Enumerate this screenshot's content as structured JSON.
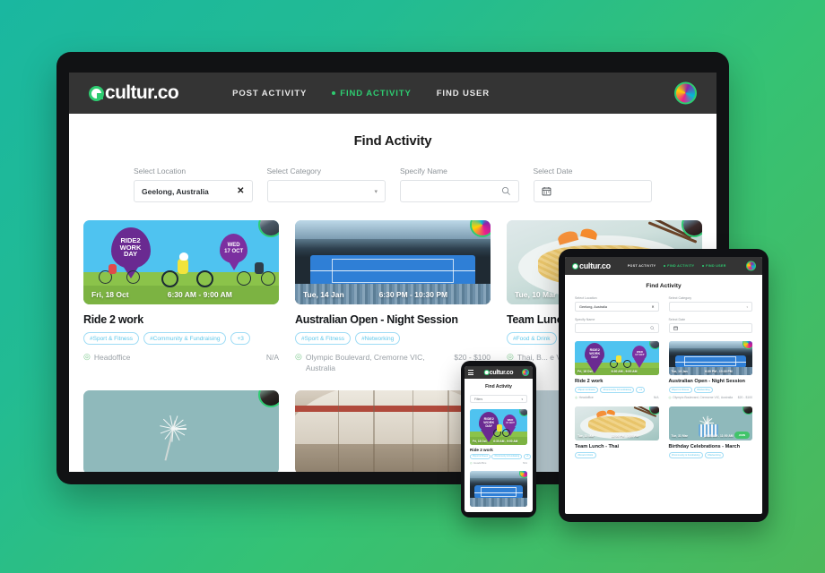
{
  "brand": {
    "name": "cultur.co",
    "accent_green": "#2ecc71",
    "nav_bg": "#343434"
  },
  "background": {
    "gradient_from": "#1ab7a0",
    "gradient_to": "#4db85a"
  },
  "desktop": {
    "nav": {
      "links": [
        {
          "label": "POST ACTIVITY",
          "active": false
        },
        {
          "label": "FIND ACTIVITY",
          "active": true
        },
        {
          "label": "FIND USER",
          "active": false
        }
      ],
      "avatar_name": "user-avatar"
    },
    "page_title": "Find Activity",
    "filters": [
      {
        "label": "Select Location",
        "value": "Geelong, Australia",
        "placeholder": "",
        "control": "clearable-text"
      },
      {
        "label": "Select Category",
        "value": "",
        "placeholder": "",
        "control": "dropdown"
      },
      {
        "label": "Specify Name",
        "value": "",
        "placeholder": "",
        "control": "search"
      },
      {
        "label": "Select Date",
        "value": "",
        "placeholder": "",
        "control": "date"
      }
    ],
    "cards": [
      {
        "art": "ride",
        "date": "Fri, 18 Oct",
        "time": "6:30 AM - 9:00 AM",
        "title": "Ride 2 work",
        "tags": [
          "#Sport & Fitness",
          "#Community & Fundraising",
          "+3"
        ],
        "location": "Headoffice",
        "price": "N/A",
        "poster_art": {
          "line1": "RIDE2",
          "line2": "WORK",
          "line3": "DAY",
          "badge1": "WED",
          "badge2": "17 OCT"
        }
      },
      {
        "art": "tennis",
        "date": "Tue, 14 Jan",
        "time": "6:30 PM - 10:30 PM",
        "title": "Australian Open - Night Session",
        "tags": [
          "#Sport & Fitness",
          "#Networking"
        ],
        "location": "Olympic Boulevard, Cremorne VIC, Australia",
        "price": "$20 - $100"
      },
      {
        "art": "thai",
        "date": "Tue, 10 Mar",
        "time": "",
        "title": "Team Lunch - Thai",
        "tags": [
          "#Food & Drink"
        ],
        "location": "Thai, B... e VIC, A...",
        "price": ""
      }
    ],
    "cards_row2": [
      {
        "art": "spark",
        "title": "",
        "date": "",
        "time": ""
      },
      {
        "art": "arch",
        "title": "",
        "date": "",
        "time": ""
      },
      {
        "art": "blank",
        "title": "",
        "date": "",
        "time": ""
      }
    ]
  },
  "tablet": {
    "nav": {
      "links": [
        {
          "label": "POST ACTIVITY",
          "active": false
        },
        {
          "label": "FIND ACTIVITY",
          "active": true
        },
        {
          "label": "FIND USER",
          "active": true
        }
      ]
    },
    "page_title": "Find Activity",
    "filters": [
      {
        "label": "Select Location",
        "value": "Geelong, Australia",
        "control": "clearable-text"
      },
      {
        "label": "Select Category",
        "value": "",
        "control": "dropdown"
      },
      {
        "label": "Specify Name",
        "value": "",
        "control": "search"
      },
      {
        "label": "Select Date",
        "value": "",
        "control": "date"
      }
    ],
    "cards": [
      {
        "art": "ride",
        "date": "Fri, 18 Oct",
        "time": "6:30 AM - 9:00 AM",
        "title": "Ride 2 work",
        "tags": [
          "#Sport & Fitness",
          "#Community & Fundraising",
          "+3"
        ],
        "location": "Headoffice",
        "price": "N/A",
        "poster_art": {
          "line1": "RIDE2",
          "line2": "WORK",
          "line3": "DAY",
          "badge1": "WED",
          "badge2": "17 OCT"
        }
      },
      {
        "art": "tennis",
        "date": "Tue, 14 Jan",
        "time": "6:30 PM - 10:30 PM",
        "title": "Australian Open - Night Session",
        "tags": [
          "#Sport & Fitness",
          "#Networking"
        ],
        "location": "Olympic Boulevard, Cremorne VIC, Australia",
        "price": "$20 - $100"
      },
      {
        "art": "thai",
        "date": "Tue, 10 Mar",
        "time": "12:00 PM - 1:00 PM",
        "title": "Team Lunch - Thai",
        "tags": [
          "#Food & Drink"
        ],
        "location": "",
        "price": ""
      },
      {
        "art": "spark",
        "date": "Tue, 31 Mar",
        "time": "10:30 AM - 11:00 AM",
        "title": "Birthday Celebrations - March",
        "tags": [
          "#Community & Fundraising",
          "#Networking"
        ],
        "location": "",
        "price": "",
        "join_label": "JOIN"
      }
    ]
  },
  "phone": {
    "page_title": "Find Activity",
    "filter": {
      "label": "Filters",
      "control": "dropdown"
    },
    "cards": [
      {
        "art": "ride",
        "date": "Fri, 18 Oct",
        "time": "6:30 AM - 9:00 AM",
        "title": "Ride 2 work",
        "tags": [
          "#Sport & Fitness",
          "#Community & Fundraising",
          "+3"
        ],
        "location": "Headoffice",
        "price": "N/A",
        "poster_art": {
          "line1": "RIDE2",
          "line2": "WORK",
          "line3": "DAY",
          "badge1": "WED",
          "badge2": "17 OCT"
        }
      },
      {
        "art": "tennis",
        "date": "",
        "time": "",
        "title": "",
        "tags": [],
        "location": "",
        "price": ""
      }
    ]
  },
  "icons": {
    "search": "search-icon",
    "calendar": "calendar-icon",
    "clear": "✕",
    "caret": "▾",
    "pin": "◎"
  }
}
